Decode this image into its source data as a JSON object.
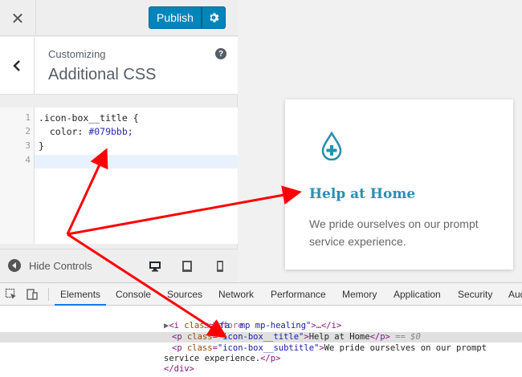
{
  "customizer": {
    "close_glyph": "✕",
    "publish_label": "Publish",
    "customizing_label": "Customizing",
    "section_title": "Additional CSS",
    "help_glyph": "?",
    "back_glyph": "‹",
    "hide_controls_label": "Hide Controls"
  },
  "editor": {
    "line_numbers": [
      "1",
      "2",
      "3",
      "4"
    ],
    "lines": [
      ".icon-box__title {",
      "  color: ",
      "}",
      ""
    ],
    "color_value": "#079bbb;"
  },
  "preview": {
    "title": "Help at Home",
    "subtitle": "We pride ourselves on our prompt service experience."
  },
  "devtools": {
    "tabs": [
      "Elements",
      "Console",
      "Sources",
      "Network",
      "Performance",
      "Memory",
      "Application",
      "Security",
      "Aud"
    ],
    "active_tab": "Elements",
    "dom": {
      "before": "::before",
      "i_open": "<i ",
      "i_attr": "class",
      "i_val": "\"fa  mp mp-healing\"",
      "i_close": ">…</i>",
      "p1_open": "<p ",
      "p1_attr": "class",
      "p1_val": "\"icon-box__title\"",
      "p1_text": "Help at Home",
      "p1_close": "</p>",
      "p1_marker": " == $0",
      "p2_open": "<p ",
      "p2_attr": "class",
      "p2_val": "\"icon-box__subtitle\"",
      "p2_text": "We pride ourselves on our prompt",
      "p2_text2": "service experience.",
      "p2_close": "</p>",
      "div_close": "</div>"
    }
  },
  "colors": {
    "accent_blue": "#0085ba",
    "title_color": "#079bbb",
    "arrow_red": "#ff0000"
  },
  "icons": [
    "close-icon",
    "gear-icon",
    "chevron-left-icon",
    "help-icon",
    "hide-controls-icon",
    "desktop-icon",
    "tablet-icon",
    "mobile-icon",
    "medical-drop-icon",
    "inspect-icon",
    "device-toggle-icon"
  ]
}
